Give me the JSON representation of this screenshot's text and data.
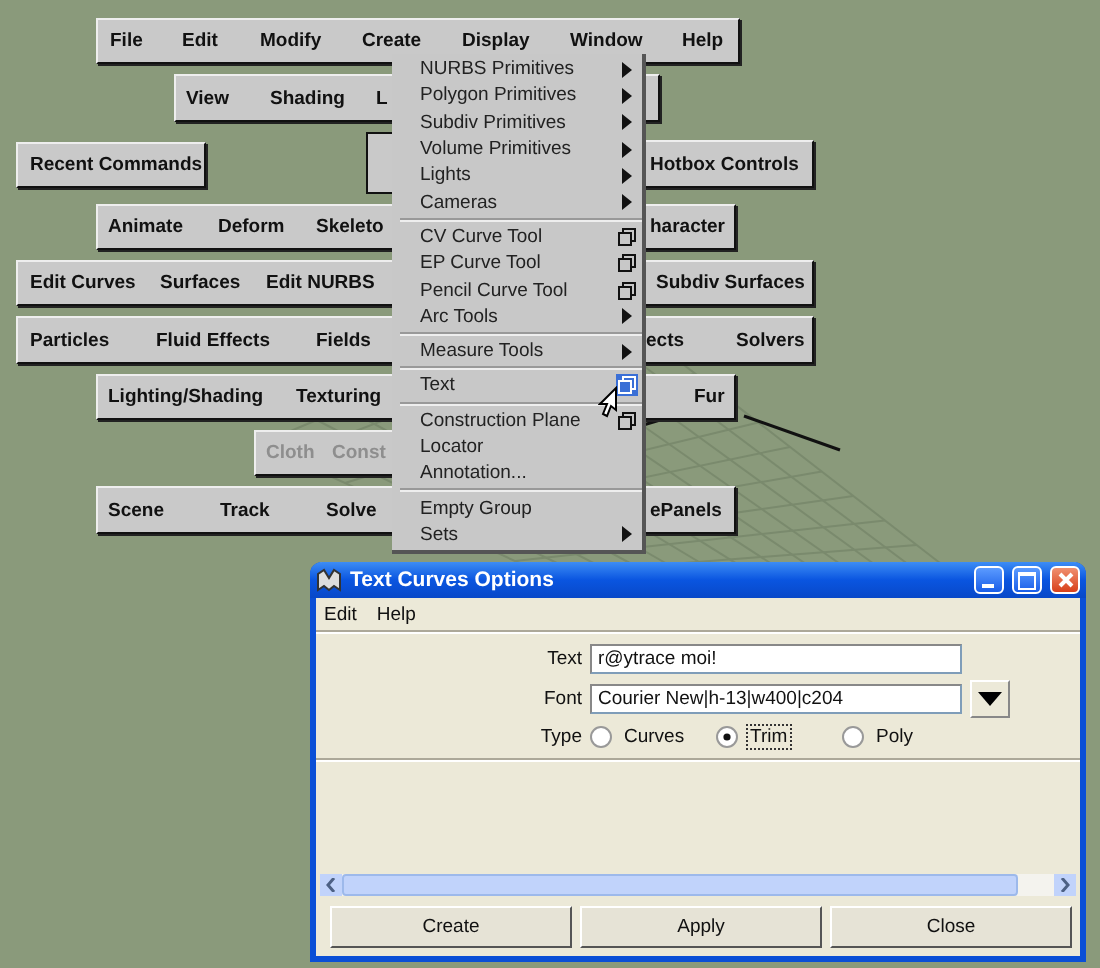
{
  "hotbox": {
    "bars": [
      {
        "disabled": false,
        "items": [
          "File",
          "Edit",
          "Modify",
          "Create",
          "Display",
          "Window",
          "Help"
        ]
      },
      {
        "disabled": false,
        "items": [
          "View",
          "Shading",
          "L"
        ]
      },
      {
        "disabled": false,
        "items": [
          "Recent Commands"
        ]
      },
      {
        "disabled": false,
        "items": [
          "Hotbox Controls"
        ]
      },
      {
        "disabled": false,
        "items": [
          "Animate",
          "Deform",
          "Skeleto",
          "haracter"
        ]
      },
      {
        "disabled": false,
        "items": [
          "Edit Curves",
          "Surfaces",
          "Edit NURBS",
          "Subdiv Surfaces"
        ]
      },
      {
        "disabled": false,
        "items": [
          "Particles",
          "Fluid Effects",
          "Fields",
          "ects",
          "Solvers"
        ]
      },
      {
        "disabled": false,
        "items": [
          "Lighting/Shading",
          "Texturing",
          "Fur"
        ]
      },
      {
        "disabled": true,
        "items": [
          "Cloth",
          "Const"
        ]
      },
      {
        "disabled": false,
        "items": [
          "Scene",
          "Track",
          "Solve",
          "ePanels"
        ]
      }
    ]
  },
  "menu": {
    "items": [
      {
        "kind": "submenu",
        "label": "NURBS Primitives",
        "highlighted": false
      },
      {
        "kind": "submenu",
        "label": "Polygon Primitives",
        "highlighted": false
      },
      {
        "kind": "submenu",
        "label": "Subdiv Primitives",
        "highlighted": false
      },
      {
        "kind": "submenu",
        "label": "Volume Primitives",
        "highlighted": false
      },
      {
        "kind": "submenu",
        "label": "Lights",
        "highlighted": false
      },
      {
        "kind": "submenu",
        "label": "Cameras",
        "highlighted": false
      },
      {
        "kind": "separator"
      },
      {
        "kind": "option",
        "label": "CV Curve Tool",
        "highlighted": false
      },
      {
        "kind": "option",
        "label": "EP Curve Tool",
        "highlighted": false
      },
      {
        "kind": "option",
        "label": "Pencil Curve Tool",
        "highlighted": false
      },
      {
        "kind": "submenu",
        "label": "Arc Tools",
        "highlighted": false
      },
      {
        "kind": "separator"
      },
      {
        "kind": "submenu",
        "label": "Measure Tools",
        "highlighted": false
      },
      {
        "kind": "separator"
      },
      {
        "kind": "option",
        "label": "Text",
        "highlighted": true
      },
      {
        "kind": "separator"
      },
      {
        "kind": "option",
        "label": "Construction Plane",
        "highlighted": false
      },
      {
        "kind": "plain",
        "label": "Locator",
        "highlighted": false
      },
      {
        "kind": "plain",
        "label": "Annotation...",
        "highlighted": false
      },
      {
        "kind": "separator"
      },
      {
        "kind": "plain",
        "label": "Empty Group",
        "highlighted": false
      },
      {
        "kind": "submenu",
        "label": "Sets",
        "highlighted": false
      }
    ]
  },
  "dialog": {
    "title": "Text Curves Options",
    "menu": [
      "Edit",
      "Help"
    ],
    "fields": [
      {
        "kind": "text",
        "label": "Text",
        "value": "r@ytrace moi!"
      },
      {
        "kind": "dropdown",
        "label": "Font",
        "value": "Courier New|h-13|w400|c204"
      }
    ],
    "type": {
      "label": "Type",
      "options": [
        {
          "label": "Curves",
          "selected": false
        },
        {
          "label": "Trim",
          "selected": true
        },
        {
          "label": "Poly",
          "selected": false
        }
      ]
    },
    "buttons": [
      "Create",
      "Apply",
      "Close"
    ]
  }
}
